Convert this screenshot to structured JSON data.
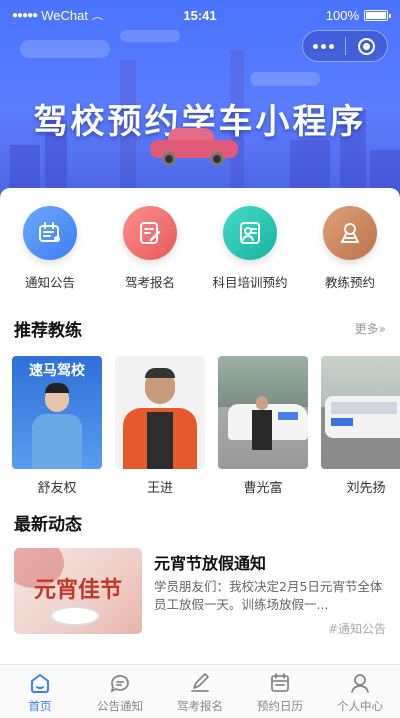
{
  "status_bar": {
    "signal": "●●●●●",
    "carrier": "WeChat",
    "time": "15:41",
    "battery": "100%"
  },
  "banner": {
    "title": "驾校预约学车小程序"
  },
  "menu": [
    {
      "label": "通知公告",
      "icon": "notice-icon",
      "color": "#4a8cf7"
    },
    {
      "label": "驾考报名",
      "icon": "signup-icon",
      "color": "#ef6b6b"
    },
    {
      "label": "科目培训预约",
      "icon": "training-icon",
      "color": "#23c2b0"
    },
    {
      "label": "教练预约",
      "icon": "coach-icon",
      "color": "#c9865a"
    }
  ],
  "coaches_section": {
    "title": "推荐教练",
    "more": "更多»"
  },
  "coaches": [
    {
      "name": "舒友权",
      "photo_text": "速马驾校"
    },
    {
      "name": "王进"
    },
    {
      "name": "曹光富"
    },
    {
      "name": "刘先扬"
    }
  ],
  "news_section": {
    "title": "最新动态"
  },
  "news": {
    "title": "元宵节放假通知",
    "desc": "学员朋友们：我校决定2月5日元宵节全体员工放假一天。训练场放假一...",
    "tag": "#通知公告",
    "thumb_text": "元宵佳节"
  },
  "tabs": [
    {
      "label": "首页",
      "icon": "home-icon",
      "active": true
    },
    {
      "label": "公告通知",
      "icon": "chat-icon",
      "active": false
    },
    {
      "label": "驾考报名",
      "icon": "edit-icon",
      "active": false
    },
    {
      "label": "预约日历",
      "icon": "calendar-icon",
      "active": false
    },
    {
      "label": "个人中心",
      "icon": "user-icon",
      "active": false
    }
  ],
  "colors": {
    "primary": "#3b82f6",
    "hero": "#4a73ff"
  }
}
